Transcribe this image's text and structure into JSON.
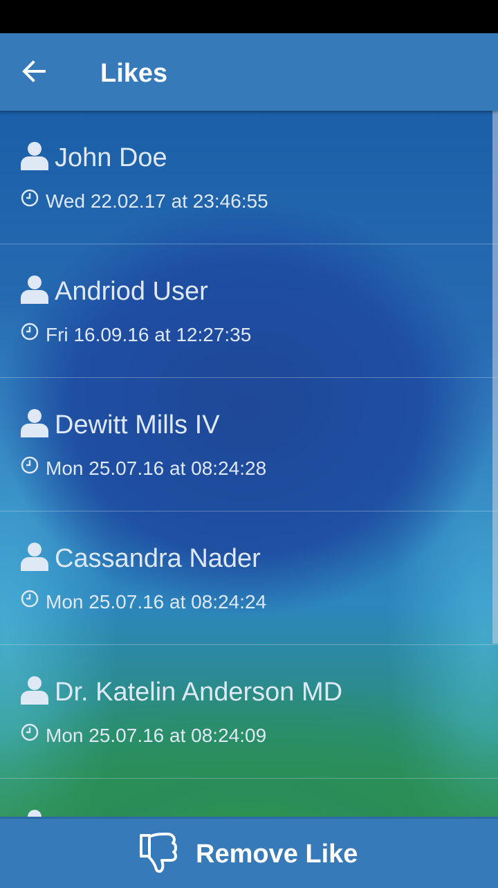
{
  "header": {
    "title": "Likes",
    "back_icon": "arrow-left-icon"
  },
  "likes": [
    {
      "name": "John Doe",
      "time": "Wed 22.02.17 at 23:46:55"
    },
    {
      "name": "Andriod User",
      "time": "Fri 16.09.16 at 12:27:35"
    },
    {
      "name": "Dewitt Mills IV",
      "time": "Mon 25.07.16 at 08:24:28"
    },
    {
      "name": "Cassandra Nader",
      "time": "Mon 25.07.16 at 08:24:24"
    },
    {
      "name": "Dr. Katelin Anderson MD",
      "time": "Mon 25.07.16 at 08:24:09"
    }
  ],
  "footer": {
    "action_label": "Remove Like",
    "action_icon": "thumbs-down-icon"
  },
  "colors": {
    "app_bar": "#367ab9",
    "text": "#dfe8f5"
  }
}
